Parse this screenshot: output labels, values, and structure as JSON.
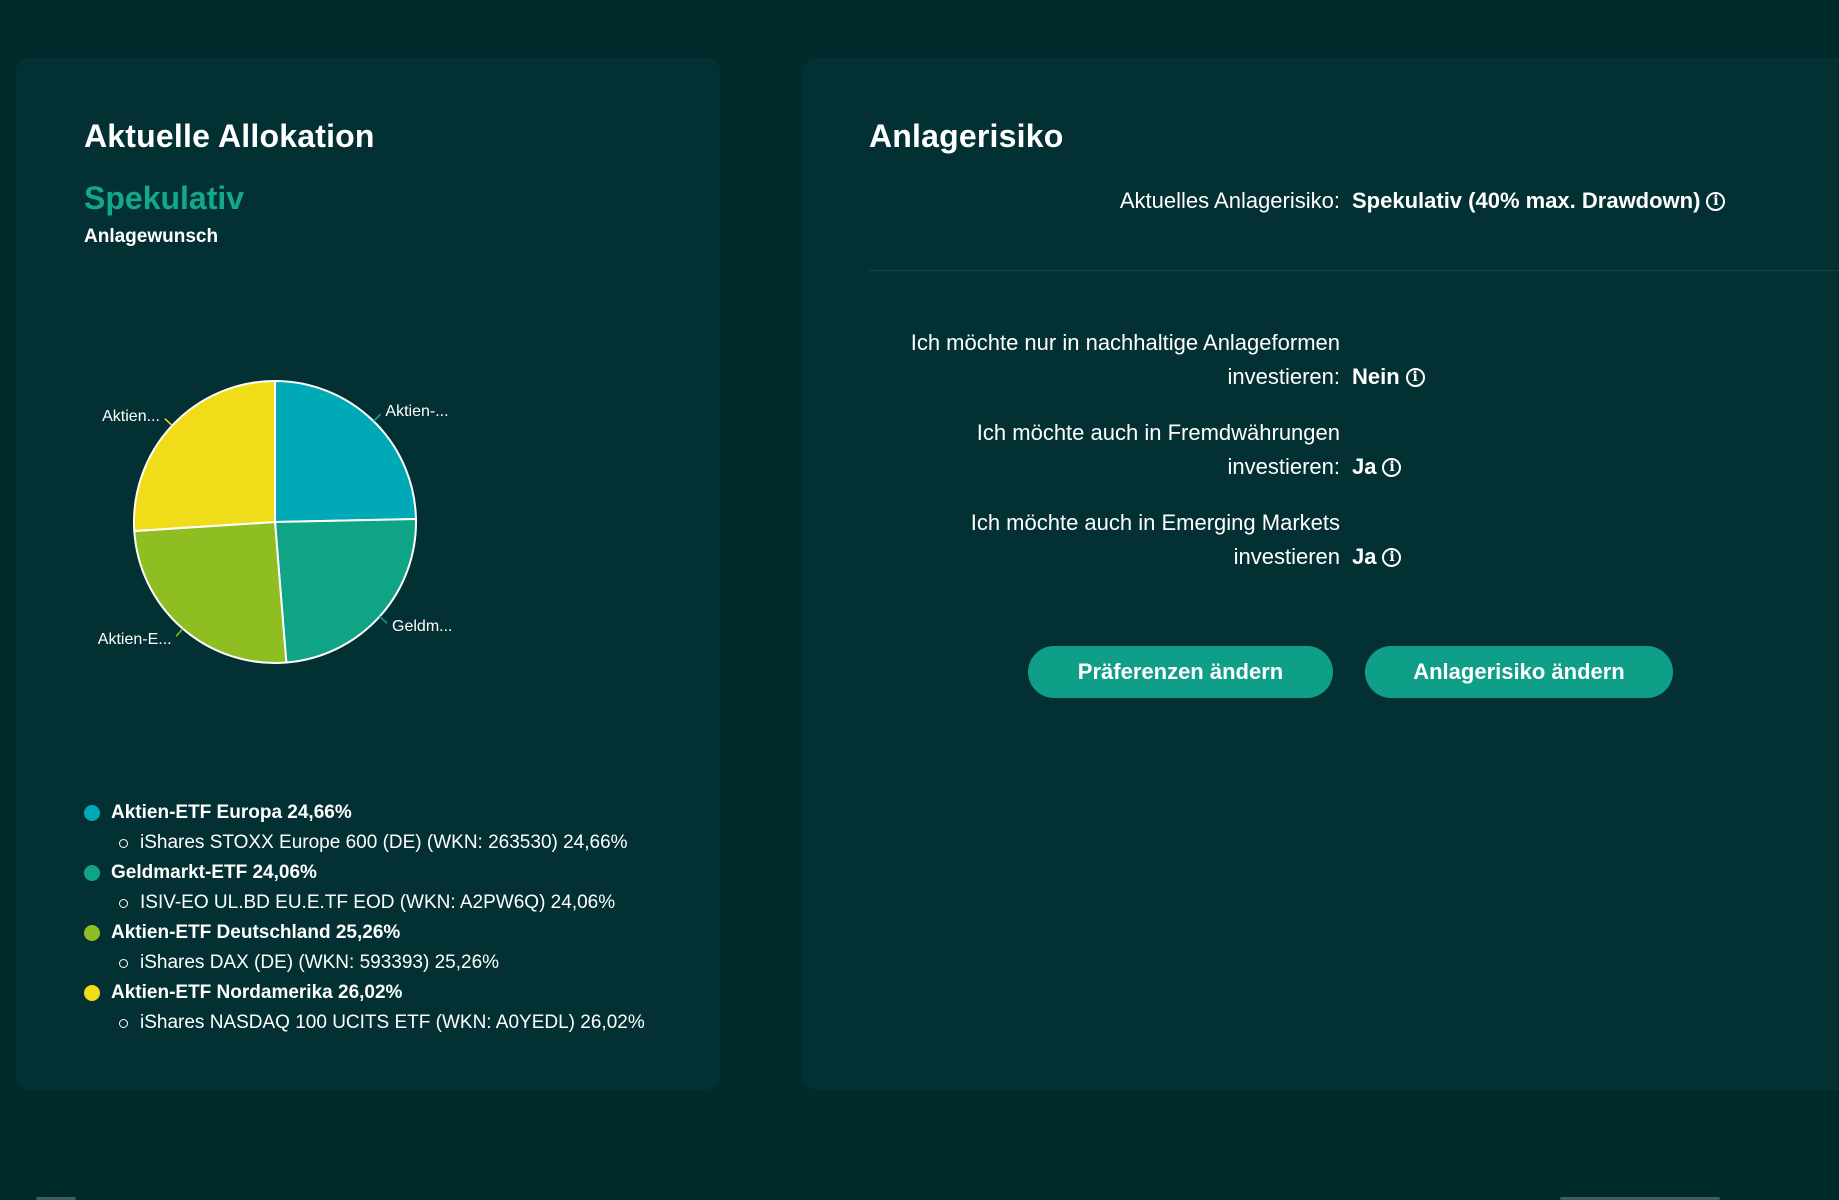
{
  "allocation": {
    "title": "Aktuelle Allokation",
    "risk_level": "Spekulativ",
    "risk_sublabel": "Anlagewunsch",
    "legend": [
      {
        "label": "Aktien-ETF Europa 24,66%",
        "sub": "iShares STOXX Europe 600 (DE) (WKN: 263530) 24,66%",
        "color": "#00a9b6"
      },
      {
        "label": "Geldmarkt-ETF 24,06%",
        "sub": "ISIV-EO UL.BD EU.E.TF EOD (WKN: A2PW6Q) 24,06%",
        "color": "#0fa486"
      },
      {
        "label": "Aktien-ETF Deutschland 25,26%",
        "sub": "iShares DAX (DE) (WKN: 593393) 25,26%",
        "color": "#8fbe23"
      },
      {
        "label": "Aktien-ETF Nordamerika 26,02%",
        "sub": "iShares NASDAQ 100 UCITS ETF (WKN: A0YEDL) 26,02%",
        "color": "#f1dc19"
      }
    ]
  },
  "chart_data": {
    "type": "pie",
    "categories": [
      "Aktien-ETF Europa",
      "Geldmarkt-ETF",
      "Aktien-ETF Deutschland",
      "Aktien-ETF Nordamerika"
    ],
    "values": [
      24.66,
      24.06,
      25.26,
      26.02
    ],
    "slice_labels": [
      "Aktien-...",
      "Geldm...",
      "Aktien-E...",
      "Aktien..."
    ],
    "colors": [
      "#00a9b6",
      "#0fa486",
      "#8fbe23",
      "#f1dc19"
    ],
    "legend_placement": "bottom"
  },
  "risk": {
    "title": "Anlagerisiko",
    "current_label": "Aktuelles Anlagerisiko:",
    "current_value": "Spekulativ (40% max. Drawdown)",
    "preferences": [
      {
        "label_line1": "Ich möchte nur in nachhaltige Anlageformen",
        "label_line2": "investieren:",
        "value": "Nein"
      },
      {
        "label_line1": "Ich möchte auch in Fremdwährungen",
        "label_line2": "investieren:",
        "value": "Ja"
      },
      {
        "label_line1": "Ich möchte auch in Emerging Markets",
        "label_line2": "investieren",
        "value": "Ja"
      }
    ],
    "buttons": {
      "change_preferences": "Präferenzen ändern",
      "change_risk": "Anlagerisiko ändern"
    }
  },
  "icons": {
    "info": "info-circle-icon"
  }
}
